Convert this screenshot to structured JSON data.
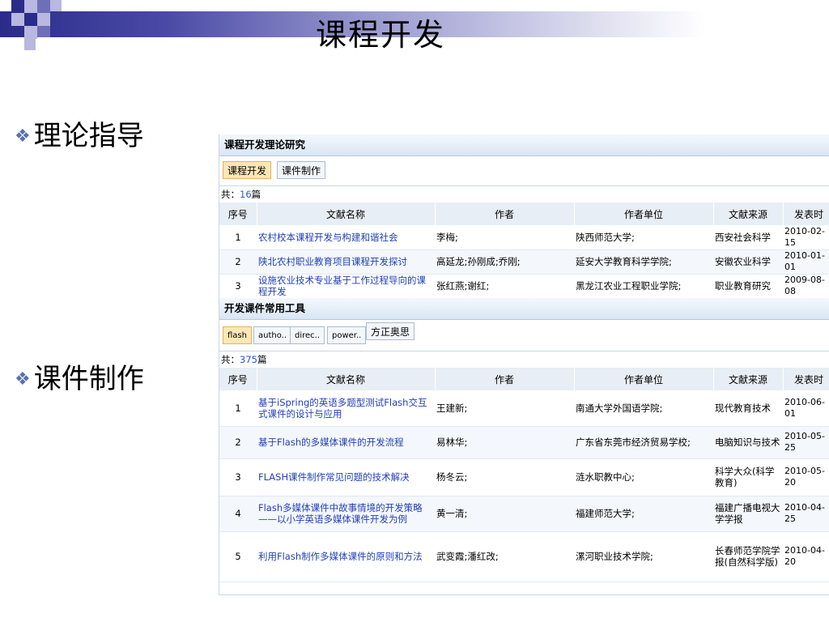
{
  "slide": {
    "title": "课程开发",
    "bullets": [
      "理论指导",
      "课件制作"
    ]
  },
  "theory_panel": {
    "title": "课程开发理论研究",
    "tabs": [
      "课程开发",
      "课件制作"
    ],
    "count_prefix": "共：",
    "count": "16",
    "count_suffix": "篇",
    "headers": [
      "序号",
      "文献名称",
      "作者",
      "作者单位",
      "文献来源",
      "发表时"
    ],
    "rows": [
      {
        "no": "1",
        "title": "农村校本课程开发与构建和谐社会",
        "author": "李梅;",
        "org": "陕西师范大学;",
        "source": "西安社会科学",
        "date": "2010-02-15"
      },
      {
        "no": "2",
        "title": "陕北农村职业教育项目课程开发探讨",
        "author": "高延龙;孙刚成;乔刚;",
        "org": "延安大学教育科学学院;",
        "source": "安徽农业科学",
        "date": "2010-01-01"
      },
      {
        "no": "3",
        "title": "设施农业技术专业基于工作过程导向的课程开发",
        "author": "张红燕;谢红;",
        "org": "黑龙江农业工程职业学院;",
        "source": "职业教育研究",
        "date": "2009-08-08"
      }
    ]
  },
  "tools_panel": {
    "title": "开发课件常用工具",
    "tabs": [
      "flash",
      "autho..",
      "direc..",
      "power..",
      "方正奥思"
    ],
    "count_prefix": "共：",
    "count": "375",
    "count_suffix": "篇",
    "headers": [
      "序号",
      "文献名称",
      "作者",
      "作者单位",
      "文献来源",
      "发表时"
    ],
    "rows": [
      {
        "no": "1",
        "title": "基于iSpring的英语多题型测试Flash交互式课件的设计与应用",
        "author": "王建新;",
        "org": "南通大学外国语学院;",
        "source": "现代教育技术",
        "date": "2010-06-01"
      },
      {
        "no": "2",
        "title": "基于Flash的多媒体课件的开发流程",
        "author": "易林华;",
        "org": "广东省东莞市经济贸易学校;",
        "source": "电脑知识与技术",
        "date": "2010-05-25"
      },
      {
        "no": "3",
        "title": "FLASH课件制作常见问题的技术解决",
        "author": "杨冬云;",
        "org": "涟水职教中心;",
        "source": "科学大众(科学教育)",
        "date": "2010-05-20"
      },
      {
        "no": "4",
        "title": "Flash多媒体课件中故事情境的开发策略——以小学英语多媒体课件开发为例",
        "author": "黄一清;",
        "org": "福建师范大学;",
        "source": "福建广播电视大学学报",
        "date": "2010-04-25"
      },
      {
        "no": "5",
        "title": "利用Flash制作多媒体课件的原则和方法",
        "author": "武变霞;潘红改;",
        "org": "漯河职业技术学院;",
        "source": "长春师范学院学报(自然科学版)",
        "date": "2010-04-20"
      }
    ]
  }
}
